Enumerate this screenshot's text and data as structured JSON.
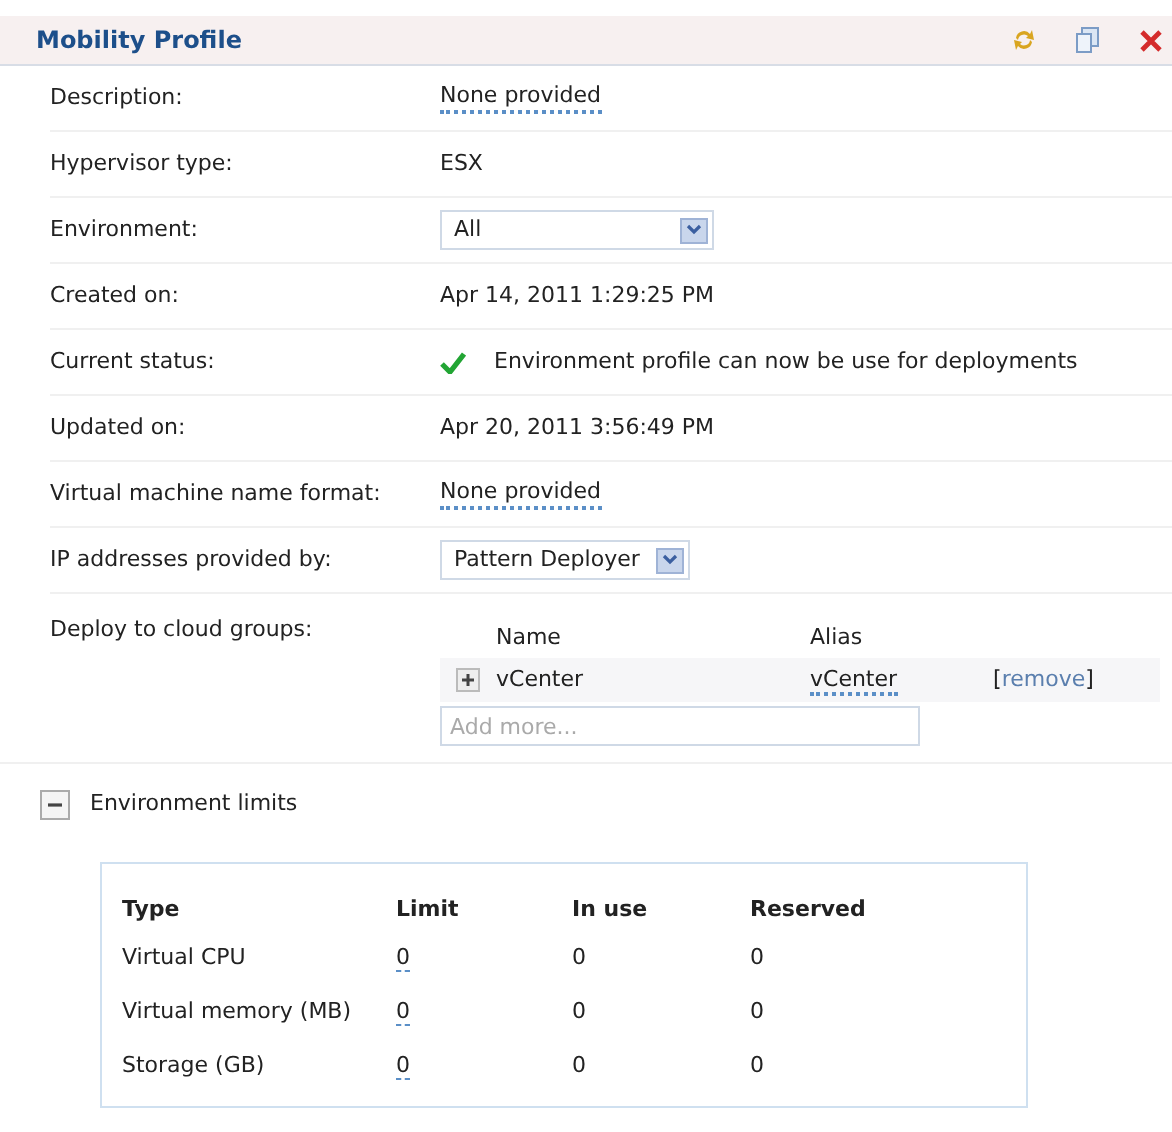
{
  "header": {
    "title": "Mobility Profile"
  },
  "fields": [
    {
      "label": "Description:",
      "kind": "editable",
      "value": "None provided"
    },
    {
      "label": "Hypervisor type:",
      "kind": "text",
      "value": "ESX"
    },
    {
      "label": "Environment:",
      "kind": "select",
      "value": "All"
    },
    {
      "label": "Created on:",
      "kind": "text",
      "value": "Apr 14, 2011 1:29:25 PM"
    },
    {
      "label": "Current status:",
      "kind": "status",
      "value": "Environment profile can now be use for deployments"
    },
    {
      "label": "Updated on:",
      "kind": "text",
      "value": "Apr 20, 2011 3:56:49 PM"
    },
    {
      "label": "Virtual machine name format:",
      "kind": "editable",
      "value": "None provided"
    },
    {
      "label": "IP addresses provided by:",
      "kind": "select",
      "value": "Pattern Deployer"
    }
  ],
  "cloud_groups": {
    "label": "Deploy to cloud groups:",
    "columns": [
      "Name",
      "Alias"
    ],
    "rows": [
      {
        "name": "vCenter",
        "alias": "vCenter",
        "action_open": "[",
        "action": "remove",
        "action_close": "]",
        "expanded": false
      }
    ],
    "placeholder": "Add more..."
  },
  "limits": {
    "title": "Environment limits",
    "expanded": true,
    "columns": [
      "Type",
      "Limit",
      "In use",
      "Reserved"
    ],
    "rows": [
      [
        "Virtual CPU",
        "0",
        "0",
        "0"
      ],
      [
        "Virtual memory (MB)",
        "0",
        "0",
        "0"
      ],
      [
        "Storage (GB)",
        "0",
        "0",
        "0"
      ]
    ]
  }
}
